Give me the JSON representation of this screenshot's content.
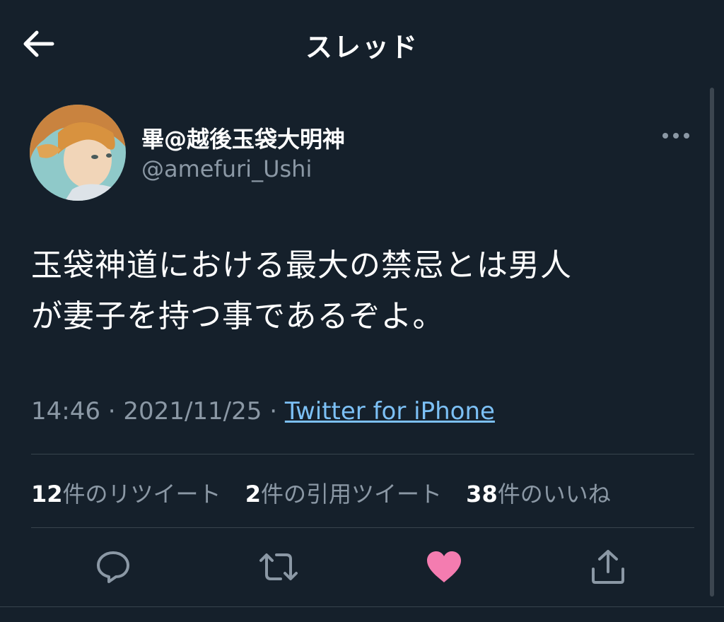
{
  "header": {
    "title": "スレッド",
    "back_icon": "arrow-left-icon"
  },
  "author": {
    "display_name": "畢@越後玉袋大明神",
    "handle": "@amefuri_Ushi",
    "avatar": "avatar-illustration"
  },
  "tweet": {
    "text_line1": "玉袋神道における最大の禁忌とは男人",
    "text_line2": "が妻子を持つ事であるぞよ。",
    "time": "14:46",
    "separator": " · ",
    "date": "2021/11/25",
    "source": "Twitter for iPhone"
  },
  "stats": {
    "retweets_count": "12",
    "retweets_label": "件のリツイート",
    "quotes_count": "2",
    "quotes_label": "件の引用ツイート",
    "likes_count": "38",
    "likes_label": "件のいいね"
  },
  "actions": {
    "reply_icon": "comment-icon",
    "retweet_icon": "retweet-icon",
    "like_icon": "heart-icon",
    "share_icon": "share-icon"
  },
  "colors": {
    "background": "#15202b",
    "secondary_text": "#8b98a5",
    "link": "#7cc0f5",
    "like": "#f47cb0",
    "divider": "#38444d"
  }
}
